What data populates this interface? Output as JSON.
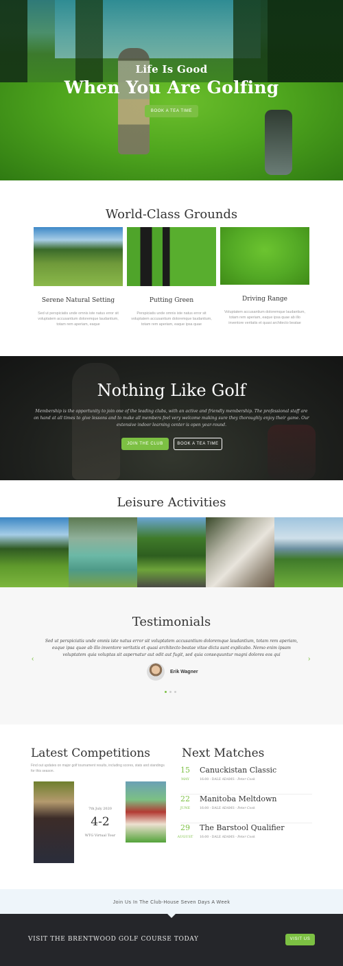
{
  "hero": {
    "subtitle": "Life Is Good",
    "title": "When You Are Golfing",
    "button": "BOOK A TEA TIME"
  },
  "grounds": {
    "title": "World-Class Grounds",
    "items": [
      {
        "title": "Serene Natural Setting",
        "text": "Sed ut perspiciatis unde omnis iste natus error sit voluptatem accusantium doloremque laudantium, totam rem aperiam, eaque"
      },
      {
        "title": "Putting Green",
        "text": "Perspiciatis unde omnis iste natus error sit voluptatem accusantium doloremque laudantium, totam rem aperiam, eaque ipsa quae"
      },
      {
        "title": "Driving Range",
        "text": "Voluptatem accusantium doloremque laudantium, totam rem aperiam, eaque ipsa quae ab illo inventore veritatis et quasi architecto beatae"
      }
    ]
  },
  "golf": {
    "title": "Nothing Like Golf",
    "text": "Membership is the opportunity to join one of the leading clubs, with an active and friendly membership. The professional staff are on hand at all times to give lessons and to make all members feel very welcome making sure they thoroughly enjoy their game. Our extensive indoor learning center is open year-round.",
    "join_button": "JOIN THE CLUB",
    "book_button": "BOOK A TEA TIME"
  },
  "leisure": {
    "title": "Leisure Activities"
  },
  "testimonials": {
    "title": "Testimonials",
    "quote": "Sed ut perspiciatis unde omnis iste natus error sit voluptatem accusantium doloremque laudantium, totam rem aperiam, eaque ipsa quae ab illo inventore veritatis et quasi architecto beatae vitae dicta sunt explicabo. Nemo enim ipsam voluptatem quia voluptas sit aspernatur aut odit aut fugit, sed quia consequuntur magni dolores eos qui",
    "name": "Erik Wagner",
    "prev": "‹",
    "next": "›"
  },
  "competitions": {
    "title": "Latest Competitions",
    "text": "Find out updates on major golf tournament results, including scores, stats and standings for this season.",
    "date": "7th July 2020",
    "score": "4-2",
    "tour": "WTG Virtual Tour"
  },
  "matches": {
    "title": "Next Matches",
    "items": [
      {
        "day": "15",
        "month": "MAY",
        "name": "Canuckistan Classic",
        "time": "16:00 - DALE ADAMS - ",
        "host": "Peter Cook"
      },
      {
        "day": "22",
        "month": "JUNE",
        "name": "Manitoba Meltdown",
        "time": "16:00 - DALE ADAMS - ",
        "host": "Peter Cook"
      },
      {
        "day": "29",
        "month": "AUGUST",
        "name": "The Barstool Qualifier",
        "time": "16:00 - DALE ADAMS - ",
        "host": "Peter Cook"
      }
    ]
  },
  "clubhouse": {
    "text": "Join Us In The Club-House Seven Days A Week"
  },
  "footer": {
    "text": "VISIT THE BRENTWOOD GOLF COURSE TODAY",
    "button": "VISIT US"
  },
  "colors": {
    "accent": "#7cc043",
    "dark": "#25262a",
    "light_bg": "#f7f7f7"
  }
}
